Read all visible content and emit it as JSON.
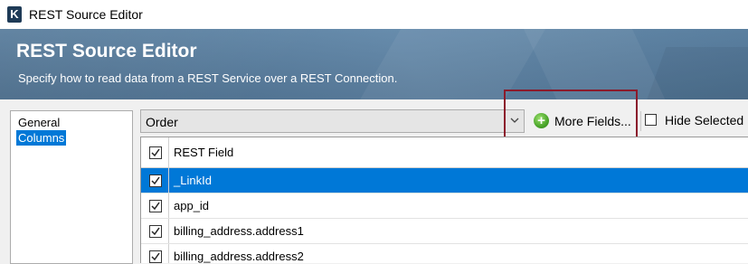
{
  "window": {
    "title": "REST Source Editor",
    "app_icon_letter": "K"
  },
  "banner": {
    "title": "REST Source Editor",
    "subtitle": "Specify how to read data from a REST Service over a REST Connection."
  },
  "nav": {
    "items": [
      {
        "label": "General",
        "selected": false
      },
      {
        "label": "Columns",
        "selected": true
      }
    ]
  },
  "toolbar": {
    "object_value": "Order",
    "more_fields_label": "More Fields...",
    "hide_selected_label": "Hide Selected",
    "hide_selected_checked": false
  },
  "grid": {
    "header": {
      "label": "REST Field",
      "checked": true
    },
    "rows": [
      {
        "label": "_LinkId",
        "checked": true,
        "selected": true
      },
      {
        "label": "app_id",
        "checked": true,
        "selected": false
      },
      {
        "label": "billing_address.address1",
        "checked": true,
        "selected": false
      },
      {
        "label": "billing_address.address2",
        "checked": true,
        "selected": false
      }
    ]
  },
  "colors": {
    "accent": "#0078d7",
    "banner": "#5a7fa0",
    "highlight": "#8b1a2b"
  },
  "icons": [
    "app-logo-icon",
    "chevron-down-icon",
    "add-circle-icon",
    "checkmark-icon"
  ]
}
